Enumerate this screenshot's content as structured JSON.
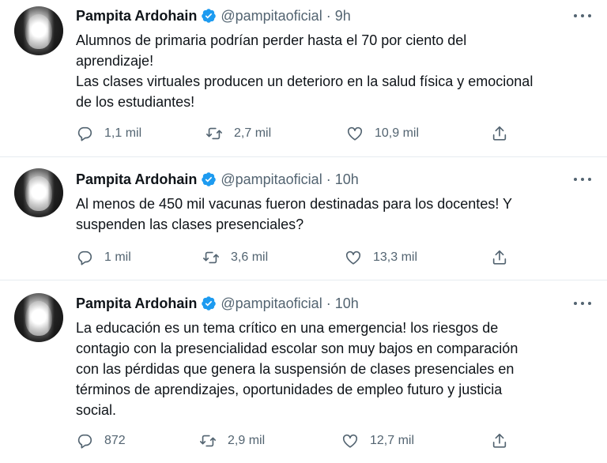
{
  "tweets": [
    {
      "name": "Pampita Ardohain",
      "handle": "@pampitaoficial",
      "separator": "·",
      "time": "9h",
      "text_lines": [
        "Alumnos de primaria podrían perder hasta el 70 por ciento del",
        "aprendizaje!",
        "Las clases virtuales producen un deterioro en la salud física y emocional",
        "de los estudiantes!"
      ],
      "replies": "1,1 mil",
      "retweets": "2,7 mil",
      "likes": "10,9 mil"
    },
    {
      "name": "Pampita Ardohain",
      "handle": "@pampitaoficial",
      "separator": "·",
      "time": "10h",
      "text_lines": [
        "Al menos de 450 mil vacunas fueron destinadas para los docentes! Y",
        "suspenden las clases presenciales?"
      ],
      "replies": "1 mil",
      "retweets": "3,6 mil",
      "likes": "13,3 mil"
    },
    {
      "name": "Pampita Ardohain",
      "handle": "@pampitaoficial",
      "separator": "·",
      "time": "10h",
      "text_lines": [
        "La educación es un tema crítico en una emergencia! los riesgos de",
        "contagio con la presencialidad escolar son muy bajos en comparación",
        "con las pérdidas que genera la suspensión de clases presenciales en",
        "términos de aprendizajes, oportunidades de empleo futuro y justicia",
        "social."
      ],
      "replies": "872",
      "retweets": "2,9 mil",
      "likes": "12,7 mil"
    }
  ],
  "icons": {
    "verified": "verified-badge-icon",
    "more": "more-options-icon",
    "reply": "reply-icon",
    "retweet": "retweet-icon",
    "like": "heart-icon",
    "share": "share-icon"
  },
  "colors": {
    "verified": "#1d9bf0",
    "secondary_text": "#536471",
    "primary_text": "#0f1419",
    "divider": "#e6ecf0"
  }
}
